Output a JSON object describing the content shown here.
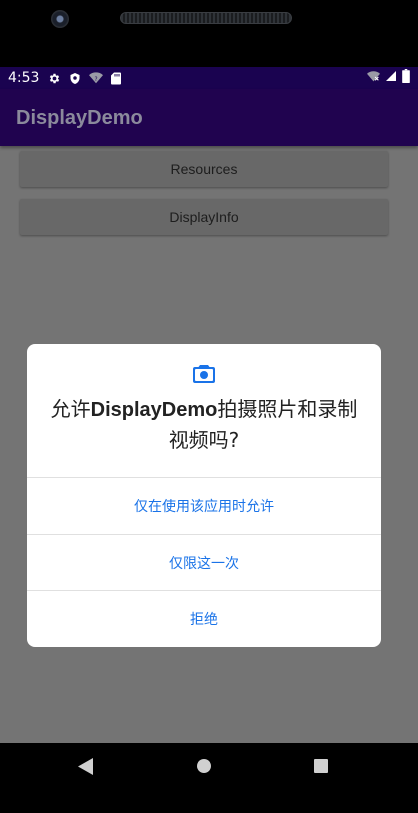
{
  "status_bar": {
    "time": "4:53",
    "icons": [
      "gear-icon",
      "shield-icon",
      "wifi-question-icon",
      "sd-card-icon",
      "wifi-x-icon",
      "signal-icon",
      "battery-icon"
    ]
  },
  "app_bar": {
    "title": "DisplayDemo"
  },
  "buttons": {
    "resources": "Resources",
    "display_info": "DisplayInfo"
  },
  "dialog": {
    "icon": "camera-icon",
    "message_prefix": "允许",
    "message_app": "DisplayDemo",
    "message_suffix": "拍摄照片和录制视频吗?",
    "options": {
      "while_using": "仅在使用该应用时允许",
      "only_once": "仅限这一次",
      "deny": "拒绝"
    }
  },
  "colors": {
    "status_bar": "#1a0350",
    "app_bar": "#20034f",
    "scrim_background": "#747474",
    "dialog_accent": "#1a73e8"
  },
  "nav_bar": {
    "icons": [
      "back-icon",
      "home-icon",
      "recents-icon"
    ]
  }
}
